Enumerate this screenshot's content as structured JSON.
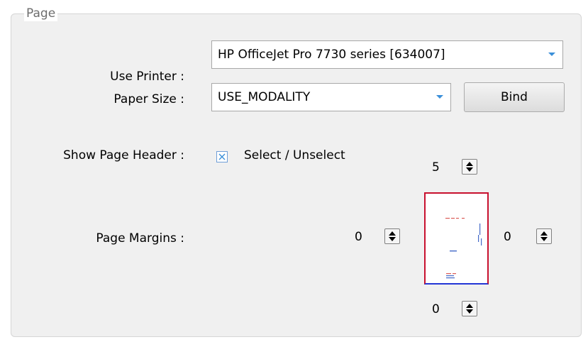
{
  "group": {
    "title": "Page"
  },
  "printer": {
    "label": "Use Printer :",
    "value": "HP OfficeJet Pro 7730 series [634007]"
  },
  "paper": {
    "label": "Paper Size :",
    "value": "USE_MODALITY",
    "bind_label": "Bind"
  },
  "header": {
    "label": "Show Page Header :",
    "checked": true,
    "checkbox_label": "Select / Unselect"
  },
  "margins": {
    "label": "Page Margins :",
    "top": "5",
    "left": "0",
    "right": "0",
    "bottom": "0"
  },
  "icons": {
    "dropdown": "chevron-down-icon",
    "check": "check-x-icon",
    "spinner": "up-down-arrows-icon"
  },
  "colors": {
    "dropdown_arrow": "#3a8fd9",
    "checkbox_mark": "#3a8fd9",
    "preview_border_red": "#c8102e",
    "preview_border_blue": "#2336d6"
  }
}
